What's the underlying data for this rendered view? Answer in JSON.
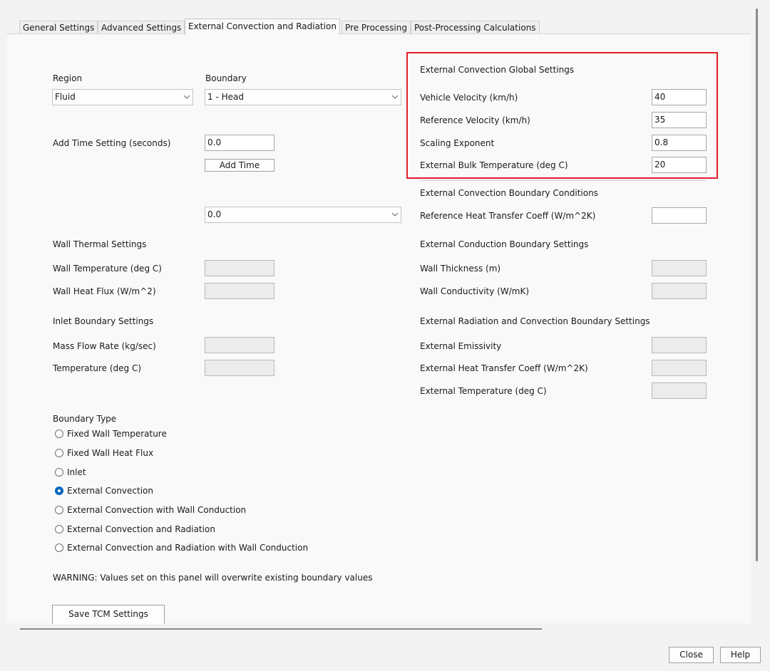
{
  "tabs": [
    {
      "label": "General Settings"
    },
    {
      "label": "Advanced Settings"
    },
    {
      "label": "External Convection and Radiation",
      "active": true
    },
    {
      "label": "Pre Processing"
    },
    {
      "label": "Post-Processing Calculations"
    }
  ],
  "region": {
    "label": "Region",
    "value": "Fluid"
  },
  "boundary": {
    "label": "Boundary",
    "value": "1 - Head"
  },
  "time": {
    "label": "Add Time Setting (seconds)",
    "value": "0.0",
    "add_button": "Add Time",
    "dropdown_value": "0.0"
  },
  "wall_thermal": {
    "heading": "Wall Thermal Settings",
    "wall_temp_label": "Wall Temperature (deg C)",
    "wall_flux_label": "Wall Heat Flux (W/m^2)"
  },
  "inlet": {
    "heading": "Inlet Boundary Settings",
    "mass_flow_label": "Mass Flow Rate (kg/sec)",
    "temperature_label": "Temperature (deg C)"
  },
  "boundary_type": {
    "heading": "Boundary Type",
    "options": [
      {
        "label": "Fixed Wall Temperature",
        "checked": false
      },
      {
        "label": "Fixed Wall Heat Flux",
        "checked": false
      },
      {
        "label": "Inlet",
        "checked": false
      },
      {
        "label": "External Convection",
        "checked": true
      },
      {
        "label": "External Convection with Wall Conduction",
        "checked": false
      },
      {
        "label": "External Convection and Radiation",
        "checked": false
      },
      {
        "label": "External Convection and Radiation with Wall Conduction",
        "checked": false
      }
    ]
  },
  "warning": "WARNING: Values set on this panel will overwrite existing boundary values",
  "save_button": "Save TCM Settings",
  "global": {
    "heading": "External Convection Global Settings",
    "vehicle_velocity_label": "Vehicle Velocity (km/h)",
    "vehicle_velocity_value": "40",
    "reference_velocity_label": "Reference Velocity (km/h)",
    "reference_velocity_value": "35",
    "scaling_exponent_label": "Scaling Exponent",
    "scaling_exponent_value": "0.8",
    "bulk_temp_label": "External Bulk Temperature (deg C)",
    "bulk_temp_value": "20"
  },
  "conv_bc": {
    "heading": "External Convection Boundary Conditions",
    "ref_htc_label": "Reference Heat Transfer Coeff (W/m^2K)",
    "ref_htc_value": ""
  },
  "conduction": {
    "heading": "External Conduction Boundary Settings",
    "thickness_label": "Wall Thickness (m)",
    "conductivity_label": "Wall Conductivity (W/mK)"
  },
  "radiation": {
    "heading": "External Radiation and Convection Boundary Settings",
    "emissivity_label": "External Emissivity",
    "htc_label": "External Heat Transfer Coeff (W/m^2K)",
    "temp_label": "External Temperature (deg C)"
  },
  "footer": {
    "close": "Close",
    "help": "Help"
  },
  "colors": {
    "highlight": "#e0202a",
    "radio_accent": "#0067c0"
  }
}
